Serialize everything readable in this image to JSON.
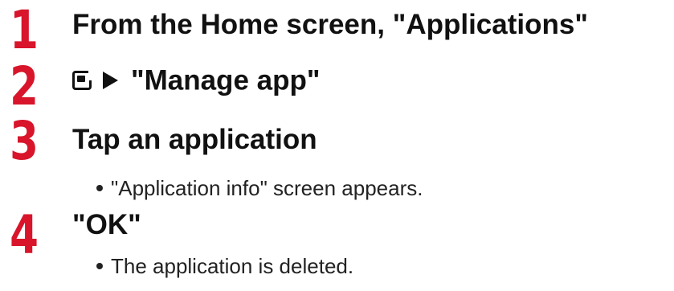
{
  "steps": [
    {
      "number": "1",
      "text": "From the Home screen, \"Applications\""
    },
    {
      "number": "2",
      "icons": [
        "menu-icon",
        "arrow-right-icon"
      ],
      "text": "\"Manage app\""
    },
    {
      "number": "3",
      "text": "Tap an application",
      "note": "\"Application info\" screen appears."
    },
    {
      "number": "4",
      "text": "\"OK\"",
      "note": "The application is deleted."
    }
  ],
  "colors": {
    "step_number": "#d8152b",
    "text": "#111111"
  }
}
